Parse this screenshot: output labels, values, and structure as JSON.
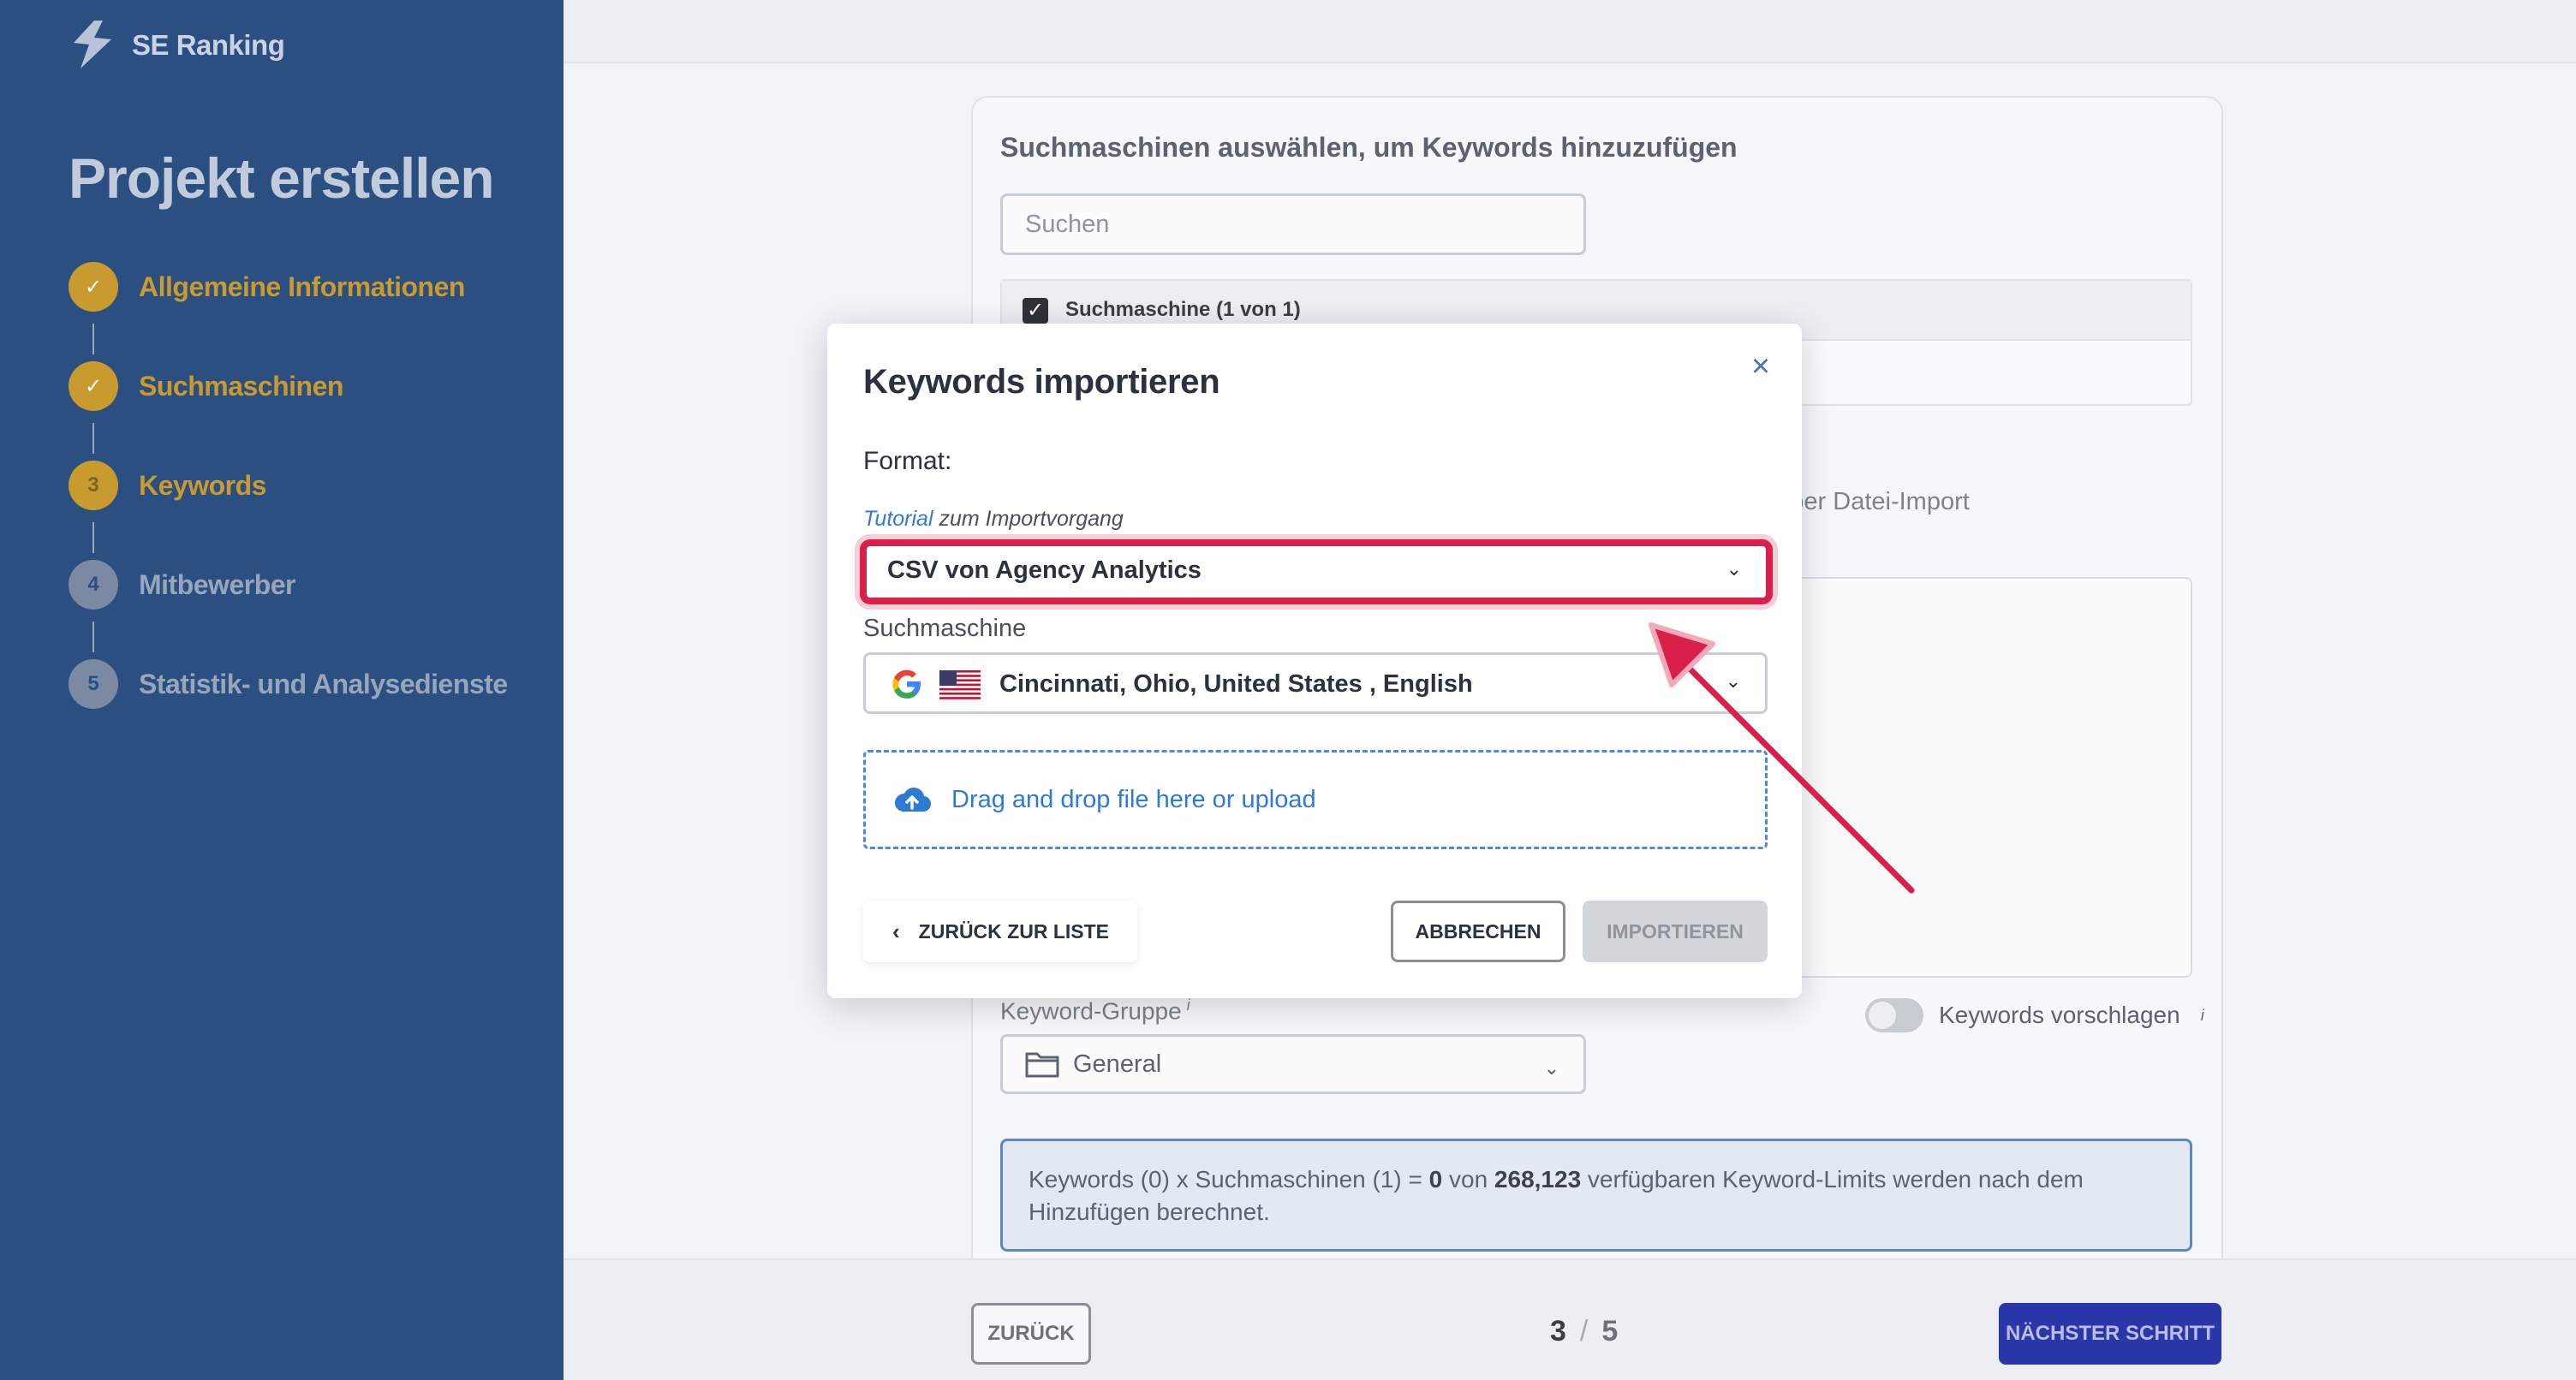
{
  "app": {
    "name": "SE Ranking"
  },
  "sidebar": {
    "title": "Projekt erstellen",
    "steps": [
      {
        "number": "",
        "label": "Allgemeine Informationen",
        "status": "done"
      },
      {
        "number": "",
        "label": "Suchmaschinen",
        "status": "done"
      },
      {
        "number": "3",
        "label": "Keywords",
        "status": "active"
      },
      {
        "number": "4",
        "label": "Mitbewerber",
        "status": "todo"
      },
      {
        "number": "5",
        "label": "Statistik- und Analysedienste",
        "status": "todo"
      }
    ]
  },
  "main": {
    "heading": "Suchmaschinen auswählen, um Keywords hinzuzufügen",
    "search_placeholder": "Suchen",
    "engine_table_header": "Suchmaschine (1 von 1)",
    "partial_text": "n oder per Datei-Import",
    "group_label": "Keyword-Gruppe",
    "group_value": "General",
    "suggest_label": "Keywords vorschlagen",
    "info_prefix": "Keywords (0) x Suchmaschinen (1) = ",
    "info_zero": "0",
    "info_mid": " von ",
    "info_limit": "268,123",
    "info_suffix": " verfügbaren Keyword-Limits werden nach dem Hinzufügen berechnet."
  },
  "footer": {
    "back_label": "ZURÜCK",
    "page_current": "3",
    "page_sep": "/",
    "page_total": "5",
    "next_label": "NÄCHSTER SCHRITT"
  },
  "modal": {
    "title": "Keywords importieren",
    "close_icon": "×",
    "format_label": "Format:",
    "tutorial_link": "Tutorial",
    "tutorial_rest": " zum Importvorgang",
    "format_value": "CSV von Agency Analytics",
    "engine_label": "Suchmaschine",
    "engine_value": "Cincinnati, Ohio, United States , English",
    "dropzone_text": "Drag and drop file here or upload",
    "back_to_list": "ZURÜCK ZUR LISTE",
    "cancel": "ABBRECHEN",
    "import": "IMPORTIEREN"
  },
  "colors": {
    "sidebar": "#2a4f80",
    "gold": "#c99a2e",
    "highlight": "#d8204a",
    "link": "#2e7bd3",
    "primary": "#2b36a8"
  },
  "icons": [
    "logo-icon",
    "check-icon",
    "close-icon",
    "chevron-down-icon",
    "google-icon",
    "us-flag-icon",
    "folder-icon",
    "upload-cloud-icon",
    "chevron-left-icon",
    "annotation-arrow"
  ]
}
